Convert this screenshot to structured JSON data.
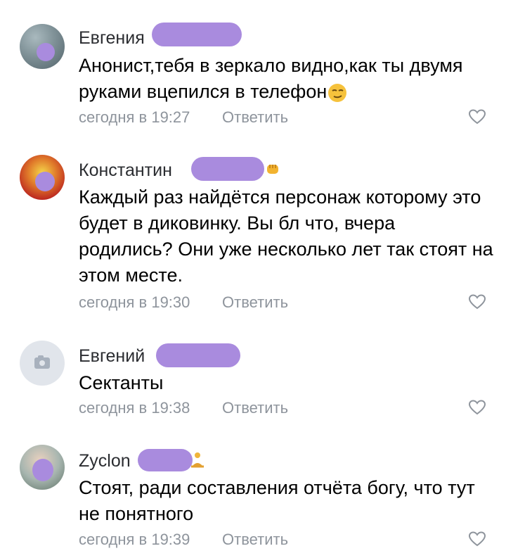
{
  "comments": [
    {
      "name": "Евгения",
      "text": "Анонист,тебя в зеркало видно,как ты двумя руками вцепился в телефон",
      "time": "сегодня в 19:27",
      "reply": "Ответить",
      "emoji": "smirk-emoji"
    },
    {
      "name": "Константин",
      "text": "Каждый раз найдётся персонаж которому это будет в диковинку. Вы бл что, вчера родились? Они уже несколько лет так стоят на этом месте.",
      "time": "сегодня в 19:30",
      "reply": "Ответить",
      "emoji": "fist-emoji"
    },
    {
      "name": "Евгений",
      "text": "Сектанты",
      "time": "сегодня в 19:38",
      "reply": "Ответить",
      "avatar": "camera-icon"
    },
    {
      "name": "Zyclon",
      "text": "Стоят, ради составления отчёта богу, что тут не понятного",
      "time": "сегодня в 19:39",
      "reply": "Ответить",
      "emoji": "meditation-emoji"
    }
  ],
  "colors": {
    "redaction": "#a98bde",
    "meta": "#8e949c",
    "text": "#000000"
  }
}
